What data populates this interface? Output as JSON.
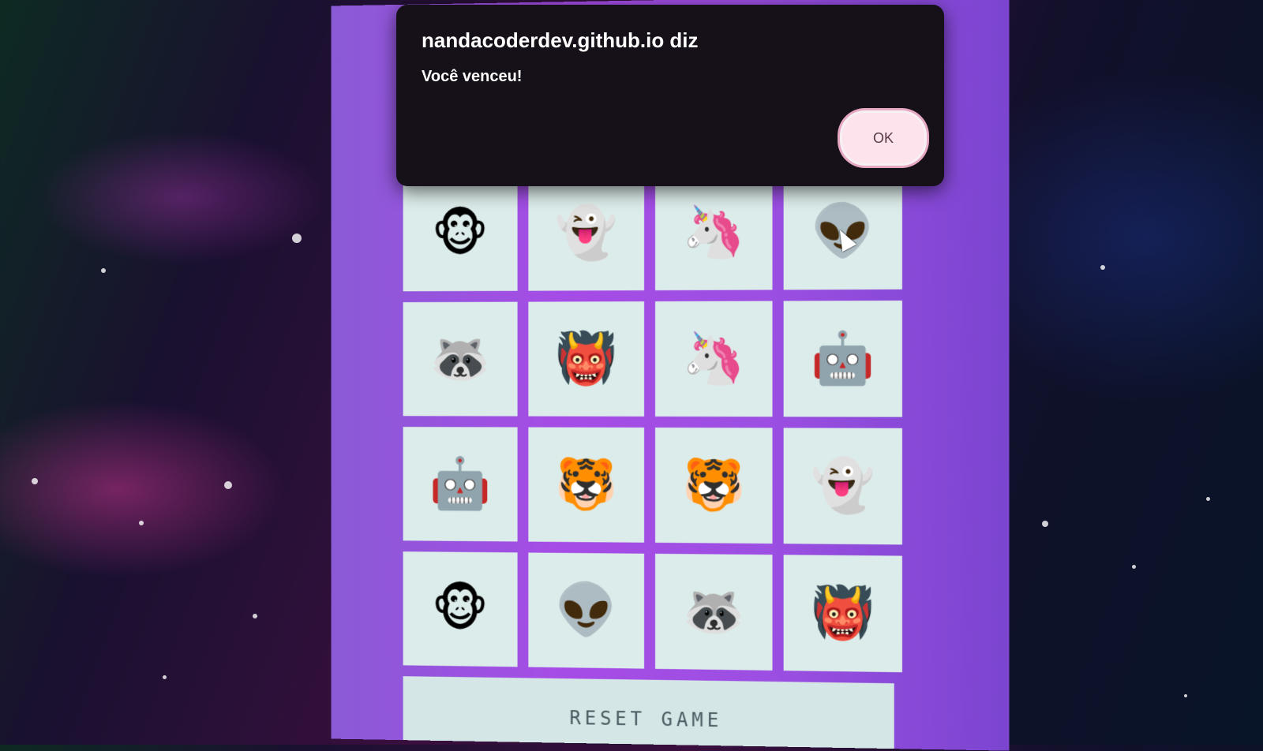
{
  "dialog": {
    "title": "nandacoderdev.github.io diz",
    "message": "Você venceu!",
    "ok_label": "OK"
  },
  "board": {
    "cards": [
      {
        "emoji": "🐵",
        "name": "monkey"
      },
      {
        "emoji": "👻",
        "name": "ghost"
      },
      {
        "emoji": "🦄",
        "name": "unicorn"
      },
      {
        "emoji": "👽",
        "name": "alien"
      },
      {
        "emoji": "🦝",
        "name": "raccoon"
      },
      {
        "emoji": "👹",
        "name": "ogre"
      },
      {
        "emoji": "🦄",
        "name": "unicorn"
      },
      {
        "emoji": "🤖",
        "name": "robot"
      },
      {
        "emoji": "🤖",
        "name": "robot"
      },
      {
        "emoji": "🐯",
        "name": "tiger"
      },
      {
        "emoji": "🐯",
        "name": "tiger"
      },
      {
        "emoji": "👻",
        "name": "ghost"
      },
      {
        "emoji": "🐵",
        "name": "monkey"
      },
      {
        "emoji": "👽",
        "name": "alien"
      },
      {
        "emoji": "🦝",
        "name": "raccoon"
      },
      {
        "emoji": "👹",
        "name": "ogre"
      }
    ]
  },
  "reset_label": "RESET GAME",
  "colors": {
    "panel": "#a64ce6",
    "card": "#dcecea",
    "dialog_bg": "#161019",
    "ok_bg": "#fde4ec"
  }
}
